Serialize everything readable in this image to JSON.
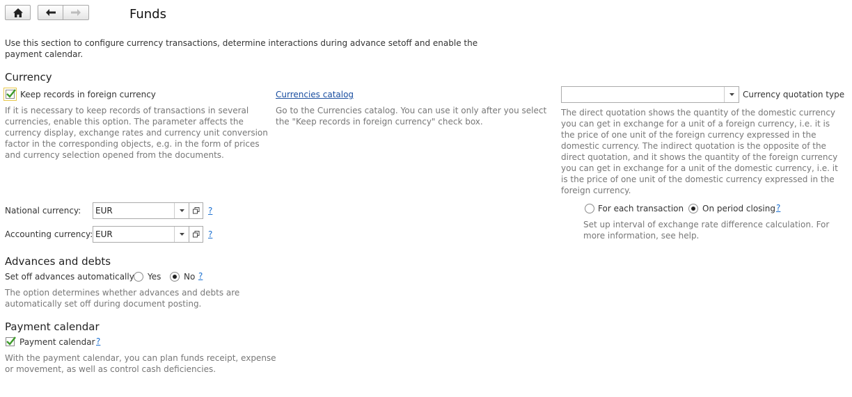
{
  "header": {
    "title": "Funds",
    "home_icon": "home-icon",
    "back_icon": "arrow-left-icon",
    "forward_icon": "arrow-right-icon"
  },
  "intro": "Use this section to configure currency transactions, determine interactions during advance setoff and enable the payment calendar.",
  "currency": {
    "section_title": "Currency",
    "keep_records_label": "Keep records in foreign currency",
    "keep_records_checked": true,
    "keep_records_hint": "If it is necessary to keep records of transactions in several currencies, enable this option. The parameter affects the currency display, exchange rates and currency unit conversion factor in the corresponding objects, e.g. in the form of prices and currency selection opened from the documents.",
    "catalog_link": "Currencies catalog",
    "catalog_hint": "Go to the Currencies catalog. You can use it only after you select the \"Keep records in foreign currency\" check box.",
    "quotation_value": "",
    "quotation_label": "Currency quotation type",
    "quotation_hint": "The direct quotation shows the quantity of the domestic currency you can get in exchange for a unit of a foreign currency, i.e. it is the price of one unit of the foreign currency expressed in the domestic currency. The indirect quotation is the opposite of the direct quotation, and it shows the quantity of the foreign currency you can get in exchange for a unit of the domestic currency, i.e. it is the price of one unit of the domestic currency expressed in the foreign currency.",
    "national_label": "National currency:",
    "national_value": "EUR",
    "accounting_label": "Accounting currency:",
    "accounting_value": "EUR",
    "help_mark": "?",
    "option_each": "For each transaction",
    "option_period": "On period closing",
    "selected_option": "On period closing",
    "interval_hint": "Set up interval of exchange rate difference calculation. For more information, see help."
  },
  "advances": {
    "section_title": "Advances and debts",
    "setoff_label": "Set off advances automatically:",
    "yes": "Yes",
    "no": "No",
    "selected": "No",
    "help_mark": "?",
    "hint": "The option determines whether advances and debts are automatically set off during document posting."
  },
  "payment": {
    "section_title": "Payment calendar",
    "checkbox_label": "Payment calendar",
    "checked": true,
    "help_mark": "?",
    "hint": "With the payment calendar, you can plan funds receipt, expense or movement, as well as control cash deficiencies."
  },
  "colors": {
    "check_green": "#3d9a2a",
    "link_blue": "#1a4ea0",
    "hint_gray": "#777777",
    "focus_yellow": "#e8c84a"
  }
}
